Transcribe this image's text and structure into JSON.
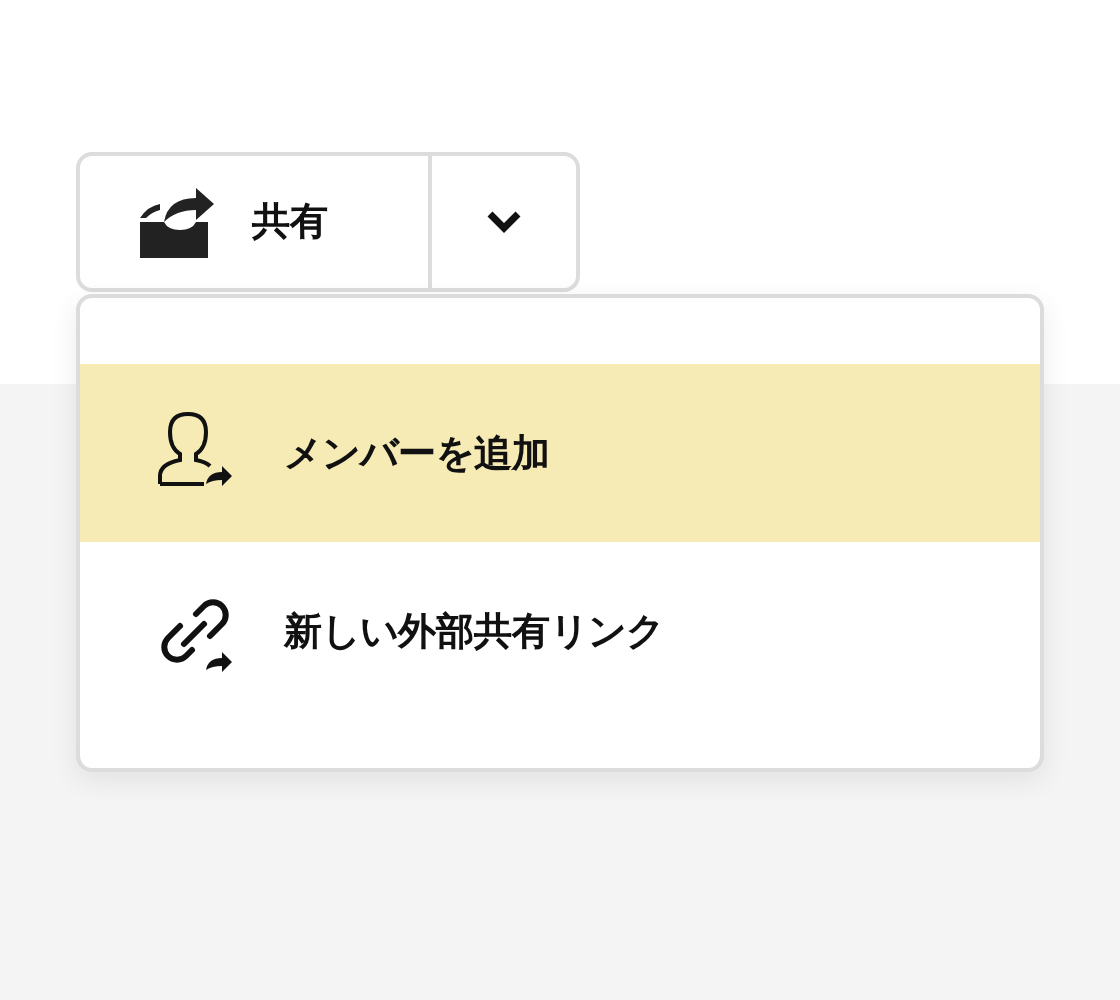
{
  "share_button": {
    "label": "共有"
  },
  "menu": {
    "items": [
      {
        "kind": "member",
        "label": "メンバーを追加",
        "selected": true
      },
      {
        "kind": "link",
        "label": "新しい外部共有リンク",
        "selected": false
      }
    ]
  }
}
